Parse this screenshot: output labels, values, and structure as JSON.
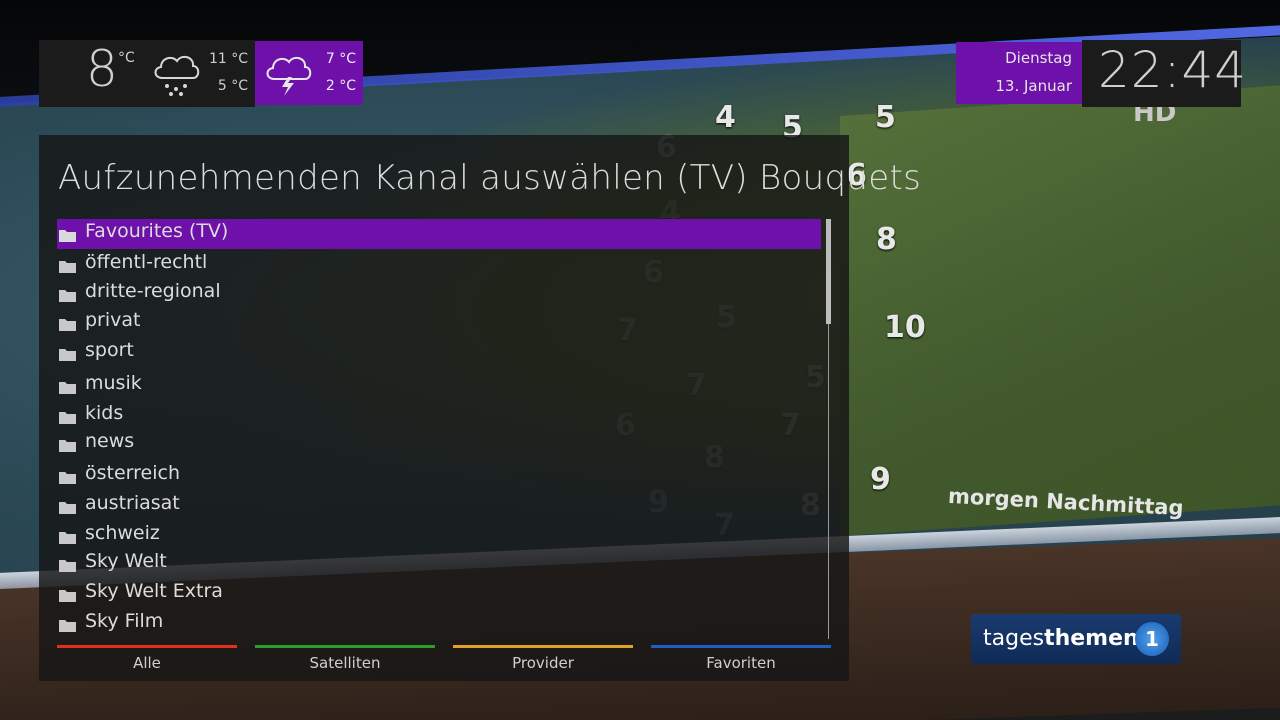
{
  "weather": {
    "current": {
      "temperature": "8",
      "unit": "°C",
      "icon": "rain-cloud-icon",
      "max": "11 °C",
      "min": "5 °C"
    },
    "forecast": {
      "icon": "thunderstorm-cloud-icon",
      "max": "7 °C",
      "min": "2 °C"
    }
  },
  "datetime": {
    "weekday": "Dienstag",
    "date": "13. Januar",
    "time": "22:44"
  },
  "panel": {
    "title": "Aufzunehmenden Kanal auswählen (TV) Bouquets",
    "selected_index": 0,
    "items": [
      {
        "label": "Favourites (TV)",
        "icon": "folder-icon"
      },
      {
        "label": "öffentl-rechtl",
        "icon": "folder-icon"
      },
      {
        "label": "dritte-regional",
        "icon": "folder-icon"
      },
      {
        "label": "privat",
        "icon": "folder-icon"
      },
      {
        "label": "sport",
        "icon": "folder-icon"
      },
      {
        "label": "musik",
        "icon": "folder-icon"
      },
      {
        "label": "kids",
        "icon": "folder-icon"
      },
      {
        "label": "news",
        "icon": "folder-icon"
      },
      {
        "label": "österreich",
        "icon": "folder-icon"
      },
      {
        "label": "austriasat",
        "icon": "folder-icon"
      },
      {
        "label": "schweiz",
        "icon": "folder-icon"
      },
      {
        "label": "Sky Welt",
        "icon": "folder-icon"
      },
      {
        "label": "Sky Welt Extra",
        "icon": "folder-icon"
      },
      {
        "label": "Sky Film",
        "icon": "folder-icon"
      }
    ]
  },
  "color_keys": {
    "red": {
      "label": "Alle",
      "color": "#e0301e"
    },
    "green": {
      "label": "Satelliten",
      "color": "#2e9c2a"
    },
    "yellow": {
      "label": "Provider",
      "color": "#e0a12a"
    },
    "blue": {
      "label": "Favoriten",
      "color": "#1f5fc4"
    }
  },
  "background": {
    "map_numbers": [
      "4",
      "5",
      "5",
      "6",
      "6",
      "4",
      "8",
      "10",
      "6",
      "5",
      "7",
      "5",
      "7",
      "6",
      "7",
      "9",
      "8",
      "8",
      "9",
      "7"
    ],
    "caption": "morgen Nachmittag",
    "hd_badge": "HD",
    "logo": {
      "prefix": "tages",
      "suffix": "themen",
      "mark": "1"
    }
  },
  "colors": {
    "accent": "#6e10aa",
    "panel_bg": "#161616",
    "text": "#dcdcdc"
  }
}
